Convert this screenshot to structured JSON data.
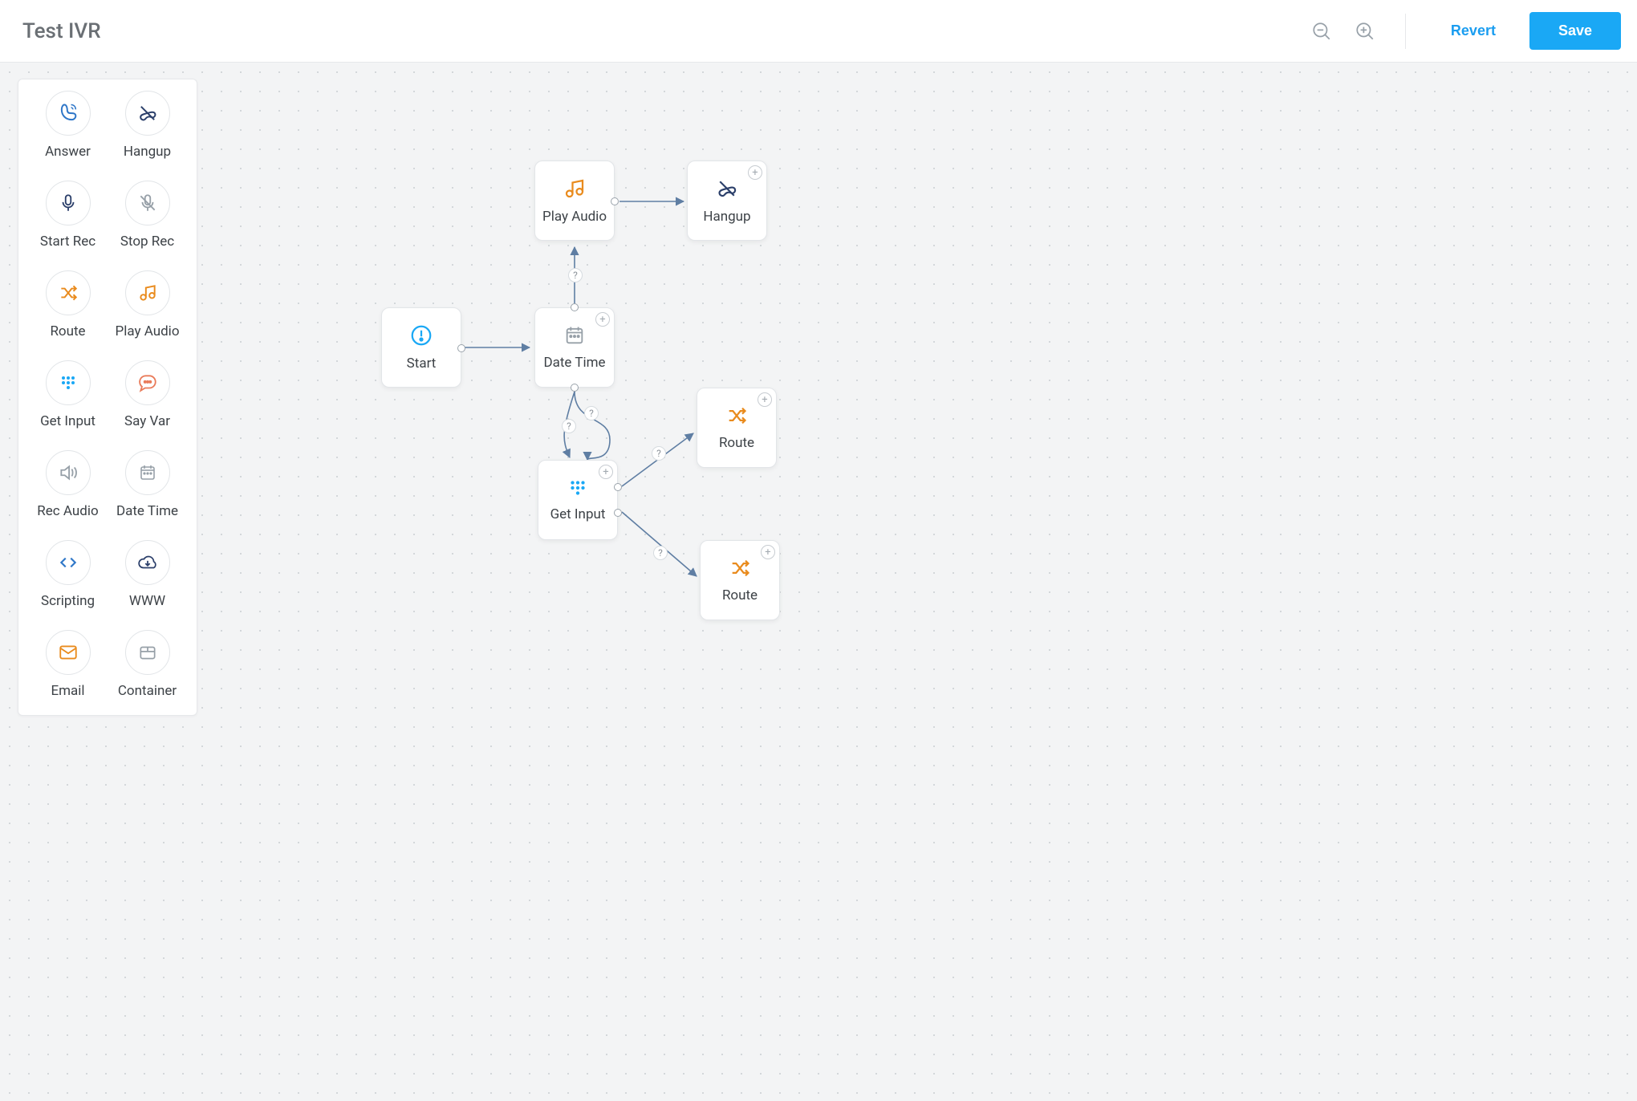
{
  "header": {
    "title": "Test IVR",
    "revert_label": "Revert",
    "save_label": "Save"
  },
  "palette": {
    "items": [
      {
        "id": "answer",
        "label": "Answer"
      },
      {
        "id": "hangup",
        "label": "Hangup"
      },
      {
        "id": "start-rec",
        "label": "Start Rec"
      },
      {
        "id": "stop-rec",
        "label": "Stop Rec"
      },
      {
        "id": "route",
        "label": "Route"
      },
      {
        "id": "play-audio",
        "label": "Play Audio"
      },
      {
        "id": "get-input",
        "label": "Get Input"
      },
      {
        "id": "say-var",
        "label": "Say Var"
      },
      {
        "id": "rec-audio",
        "label": "Rec Audio"
      },
      {
        "id": "date-time",
        "label": "Date Time"
      },
      {
        "id": "scripting",
        "label": "Scripting"
      },
      {
        "id": "www",
        "label": "WWW"
      },
      {
        "id": "email",
        "label": "Email"
      },
      {
        "id": "container",
        "label": "Container"
      }
    ]
  },
  "flow": {
    "nodes": {
      "start": {
        "label": "Start"
      },
      "date_time": {
        "label": "Date Time"
      },
      "play_audio": {
        "label": "Play Audio"
      },
      "hangup": {
        "label": "Hangup"
      },
      "get_input": {
        "label": "Get Input"
      },
      "route_a": {
        "label": "Route"
      },
      "route_b": {
        "label": "Route"
      }
    },
    "edge_labels": {
      "dt_to_play": "?",
      "dt_to_get": "?",
      "get_loop": "?",
      "get_to_ra": "?",
      "get_to_rb": "?"
    }
  }
}
